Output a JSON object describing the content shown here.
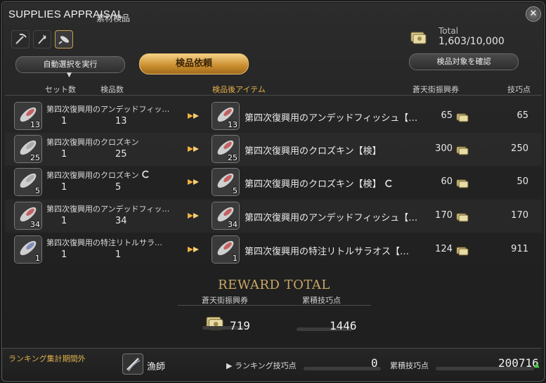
{
  "window": {
    "title": "SUPPLIES APPRAISAL",
    "subtitle": "素材検品",
    "close_glyph": "✕"
  },
  "tools": [
    {
      "icon": "pickaxe-icon",
      "selected": false
    },
    {
      "icon": "hatchet-icon",
      "selected": false
    },
    {
      "icon": "fishing-icon",
      "selected": true
    }
  ],
  "buttons": {
    "auto_select": "自動選択を実行",
    "appraise": "検品依頼",
    "confirm_targets": "検品対象を確認"
  },
  "total": {
    "label": "Total",
    "value": "1,603/10,000",
    "icon": "scrip-ticket-icon"
  },
  "columns": {
    "sets": "セット数",
    "appraised": "検品数",
    "after_item": "検品後アイテム",
    "scrip": "蒼天街振興券",
    "skill": "技巧点",
    "sort_marker": "▼"
  },
  "rows": [
    {
      "name_short": "第四次復興用のアンデッドフィッ…",
      "qty": "13",
      "sets": "1",
      "count": "13",
      "name_full": "第四次復興用のアンデッドフィッシュ【…",
      "scrip": "65",
      "skill": "65",
      "collectable": false,
      "tint": "#c03030"
    },
    {
      "name_short": "第四次復興用のクロズキン",
      "qty": "25",
      "sets": "1",
      "count": "25",
      "name_full": "第四次復興用のクロズキン【検】",
      "scrip": "300",
      "skill": "250",
      "collectable": false,
      "tint": "#9a9a9a"
    },
    {
      "name_short": "第四次復興用のクロズキン",
      "qty": "5",
      "sets": "1",
      "count": "5",
      "name_full": "第四次復興用のクロズキン【検】",
      "scrip": "60",
      "skill": "50",
      "collectable": true,
      "tint": "#9a9a9a"
    },
    {
      "name_short": "第四次復興用のアンデッドフィッ…",
      "qty": "34",
      "sets": "1",
      "count": "34",
      "name_full": "第四次復興用のアンデッドフィッシュ【…",
      "scrip": "170",
      "skill": "170",
      "collectable": false,
      "tint": "#c03030"
    },
    {
      "name_short": "第四次復興用の特注リトルサラ…",
      "qty": "1",
      "sets": "1",
      "count": "1",
      "name_full": "第四次復興用の特注リトルサラオス【…",
      "scrip": "124",
      "skill": "911",
      "collectable": false,
      "tint": "#5a6fb0"
    }
  ],
  "reward": {
    "title": "REWARD TOTAL",
    "scrip_label": "蒼天街振興券",
    "skill_label": "累積技巧点",
    "scrip_value": "719",
    "skill_value": "1446"
  },
  "ranking": {
    "status": "ランキング集計期間外",
    "job": "漁師",
    "job_icon": "fisher-icon",
    "rank_points_label": "▶ ランキング技巧点",
    "rank_points_value": "0",
    "total_points_label": "累積技巧点",
    "total_points_value": "200716",
    "up_arrow": "▲"
  },
  "colors": {
    "accent_gold": "#e7b04a",
    "button_gold": "#c98d2e",
    "up_green": "#4cc94c"
  }
}
